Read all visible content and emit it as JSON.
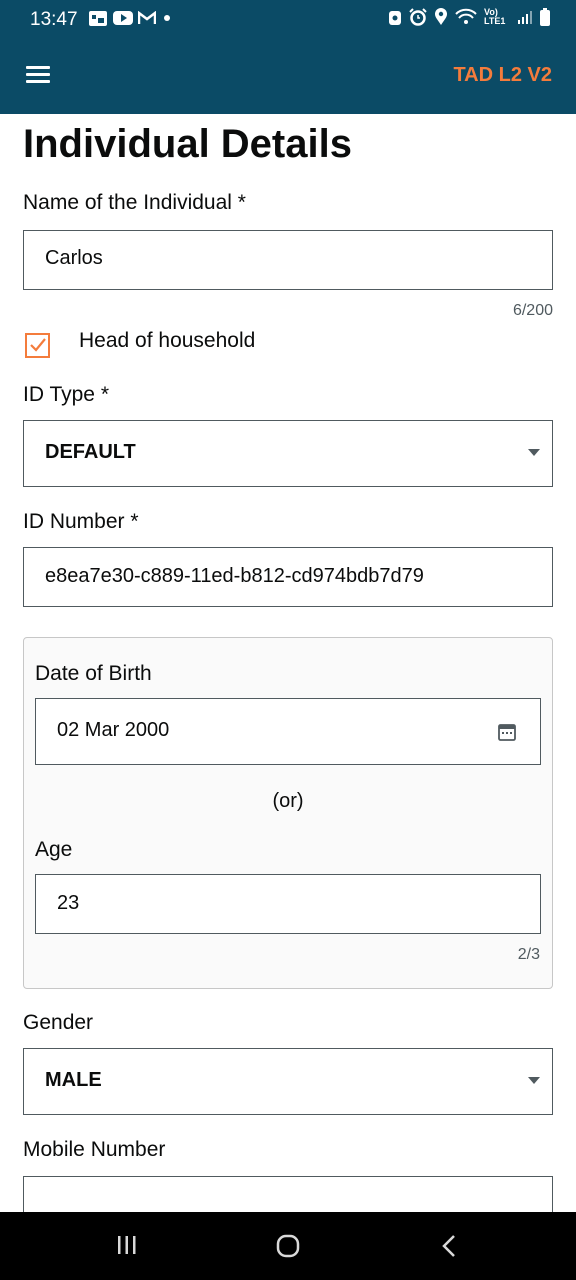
{
  "status_bar": {
    "time": "13:47",
    "network_label": "Vo) LTE1"
  },
  "app_bar": {
    "title": "TAD L2 V2"
  },
  "form": {
    "page_title": "Individual Details",
    "name_label": "Name of the Individual *",
    "name_value": "Carlos",
    "name_counter": "6/200",
    "head_of_household_label": "Head of household",
    "head_of_household_checked": true,
    "id_type_label": "ID Type *",
    "id_type_value": "DEFAULT",
    "id_number_label": "ID Number *",
    "id_number_value": "e8ea7e30-c889-11ed-b812-cd974bdb7d79",
    "dob_label": "Date of Birth",
    "dob_value": "02 Mar 2000",
    "or_text": "(or)",
    "age_label": "Age",
    "age_value": "23",
    "age_counter": "2/3",
    "gender_label": "Gender",
    "gender_value": "MALE",
    "mobile_label": "Mobile Number",
    "mobile_value": ""
  },
  "colors": {
    "primary": "#0b4b66",
    "accent": "#f47c3c",
    "text": "#0b0c0c",
    "border": "#505a5f"
  }
}
